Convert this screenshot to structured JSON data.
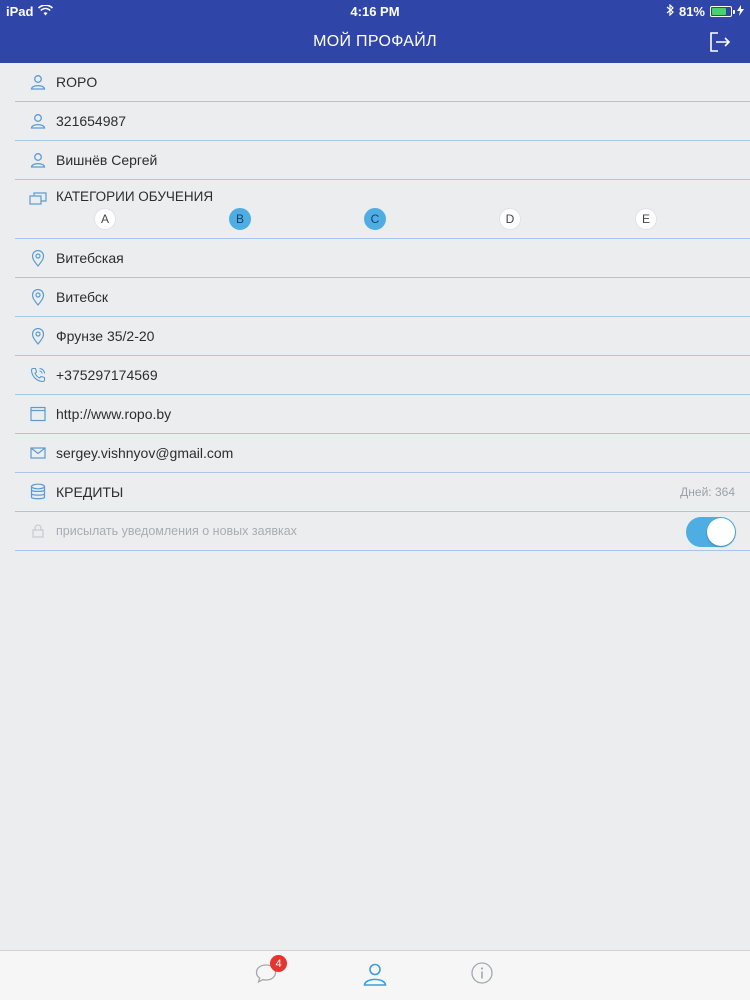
{
  "status": {
    "device": "iPad",
    "time": "4:16 PM",
    "battery": "81%",
    "battery_level": 0.81
  },
  "header": {
    "title": "МОЙ ПРОФАЙЛ"
  },
  "profile": {
    "login": "ROPO",
    "id": "321654987",
    "name": "Вишнёв Сергей",
    "categories_label": "КАТЕГОРИИ ОБУЧЕНИЯ",
    "categories": [
      {
        "label": "A",
        "active": false
      },
      {
        "label": "B",
        "active": true
      },
      {
        "label": "C",
        "active": true
      },
      {
        "label": "D",
        "active": false
      },
      {
        "label": "E",
        "active": false
      }
    ],
    "region": "Витебская",
    "city": "Витебск",
    "address": "Фрунзе 35/2-20",
    "phone": "+375297174569",
    "website": "http://www.ropo.by",
    "email": "sergey.vishnyov@gmail.com",
    "credits_label": "КРЕДИТЫ",
    "credits_days": "Дней: 364",
    "notify_label": "присылать уведомления о новых заявках",
    "notify_enabled": true
  },
  "tabbar": {
    "messages_badge": "4"
  },
  "colors": {
    "accent": "#2f46a8",
    "toggle": "#4eaee4",
    "badge": "#e5352e",
    "icon": "#5b9bd5"
  },
  "icons": [
    "wifi-icon",
    "bluetooth-icon",
    "battery-icon",
    "logout-icon",
    "user-icon",
    "categories-icon",
    "location-pin-icon",
    "phone-icon",
    "browser-icon",
    "mail-icon",
    "database-icon",
    "lock-icon",
    "chat-icon",
    "profile-icon",
    "info-icon"
  ]
}
